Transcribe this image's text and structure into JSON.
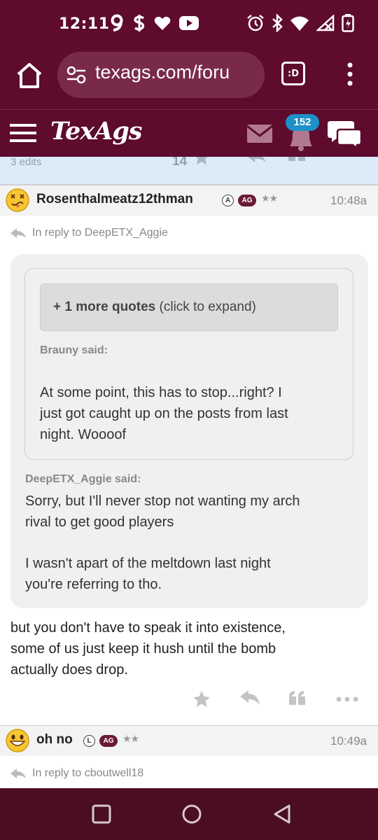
{
  "status_bar": {
    "time": "12:11",
    "left_icons": [
      "nine-icon",
      "dollar-icon",
      "heart-icon",
      "youtube-icon"
    ],
    "right_icons": [
      "alarm-icon",
      "bluetooth-icon",
      "wifi-icon",
      "signal-icon",
      "battery-icon"
    ],
    "colors": {
      "background": "#5e0b2d"
    }
  },
  "browser": {
    "url": "texags.com/foru",
    "tab_label": ":D"
  },
  "site": {
    "logo": "TexAgs",
    "notifications_count": "152"
  },
  "previous_post": {
    "edits": "3 edits",
    "star_count": "14"
  },
  "post": {
    "username": "Rosenthalmeatz12thman",
    "badge_letter": "A",
    "badge_ag": "AG",
    "stars": "★★",
    "time": "10:48a",
    "in_reply_to": "In reply to DeepETX_Aggie",
    "quote": {
      "expand_bold": "+ 1 more quotes",
      "expand_rest": " (click to expand)",
      "inner_author": "Brauny said:",
      "inner_lines": [
        "At some point, this has to stop...right? I",
        "just got caught up on the posts from last",
        "night. Woooof"
      ],
      "outer_author": "DeepETX_Aggie said:",
      "outer_lines_1": [
        "Sorry, but I'll never stop not wanting my arch",
        "rival to get good players"
      ],
      "outer_lines_2": [
        "I wasn't apart of the meltdown last night",
        "you're referring to tho."
      ]
    },
    "body_lines": [
      "but you don't have to speak it into existence,",
      "some of us just keep it hush until the bomb",
      "actually does drop."
    ]
  },
  "next_post": {
    "username": "oh no",
    "badge_letter": "L",
    "badge_ag": "AG",
    "stars": "★★",
    "time": "10:49a",
    "in_reply_to": "In reply to cboutwell18"
  },
  "nav_bar": {
    "icons": [
      "recents-square-icon",
      "home-circle-icon",
      "back-triangle-icon"
    ]
  }
}
